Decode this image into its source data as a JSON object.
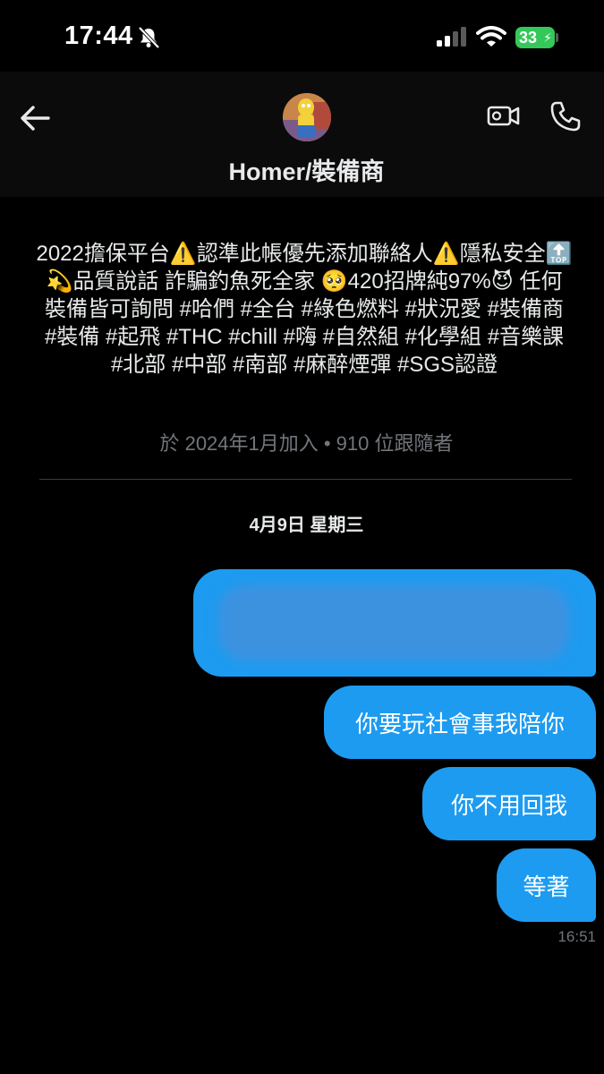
{
  "status_bar": {
    "time": "17:44",
    "battery": "33",
    "icons": [
      "bell-slash-icon",
      "signal-icon",
      "wifi-icon",
      "battery-charging-icon"
    ]
  },
  "header": {
    "contact_name": "Homer/裝備商",
    "icons": [
      "back-arrow-icon",
      "avatar",
      "video-call-icon",
      "phone-call-icon"
    ]
  },
  "profile": {
    "bio_parts": {
      "p1": "2022擔保平台",
      "warn1": "⚠️",
      "p2": "認準此帳優先添加聯絡人",
      "warn2": "⚠️",
      "p3": "隱私安全",
      "top": "🔝",
      "p4": " ",
      "dizzy": "💫",
      "p5": "品質說話 詐騙釣魚死全家 ",
      "pleading": "🥺",
      "p6": "420招牌純97%",
      "devil": "😈",
      "p7": " 任何裝備皆可詢問 #哈們 #全台 #綠色燃料 #狀況愛 #裝備商 #裝備 #起飛 #THC #chill #嗨 #自然組 #化學組 #音樂課 #北部 #中部 #南部 #麻醉煙彈 #SGS認證"
    },
    "meta": "於 2024年1月加入 • 910 位跟隨者"
  },
  "conversation": {
    "date_separator": "4月9日 星期三",
    "messages": [
      {
        "text": "",
        "redacted": true
      },
      {
        "text": "你要玩社會事我陪你"
      },
      {
        "text": "你不用回我"
      },
      {
        "text": "等著"
      }
    ],
    "last_time": "16:51"
  },
  "colors": {
    "background": "#000000",
    "bubble": "#1d9bf0",
    "muted_text": "#71767b",
    "battery": "#34c759"
  }
}
